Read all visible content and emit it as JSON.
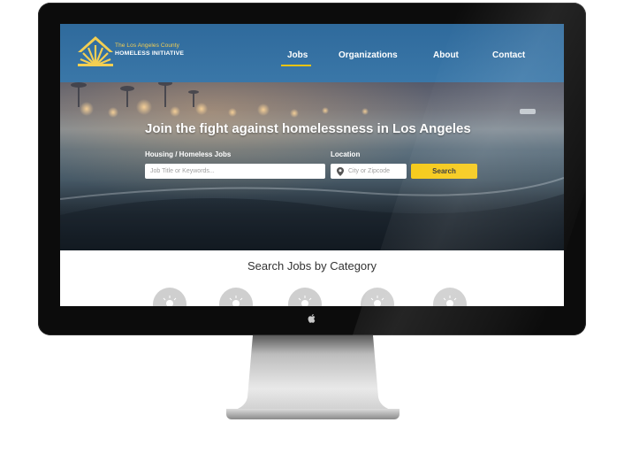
{
  "header": {
    "logo_line1": "The Los Angeles County",
    "logo_line2": "HOMELESS INITIATIVE",
    "nav": [
      {
        "label": "Jobs",
        "active": true
      },
      {
        "label": "Organizations",
        "active": false
      },
      {
        "label": "About",
        "active": false
      },
      {
        "label": "Contact",
        "active": false
      }
    ]
  },
  "hero": {
    "title": "Join the fight against homelessness in Los Angeles",
    "job_label": "Housing / Homeless Jobs",
    "job_placeholder": "Job Title or Keywords...",
    "location_label": "Location",
    "location_placeholder": "City or Zipcode",
    "search_button": "Search"
  },
  "categories": {
    "title": "Search Jobs by Category",
    "icons": [
      "lightbulb-icon",
      "lightbulb-icon",
      "lightbulb-icon",
      "lightbulb-icon",
      "lightbulb-icon"
    ]
  },
  "colors": {
    "header_blue": "#3572a3",
    "accent_yellow": "#f6c915",
    "logo_gold": "#f4cf52"
  }
}
